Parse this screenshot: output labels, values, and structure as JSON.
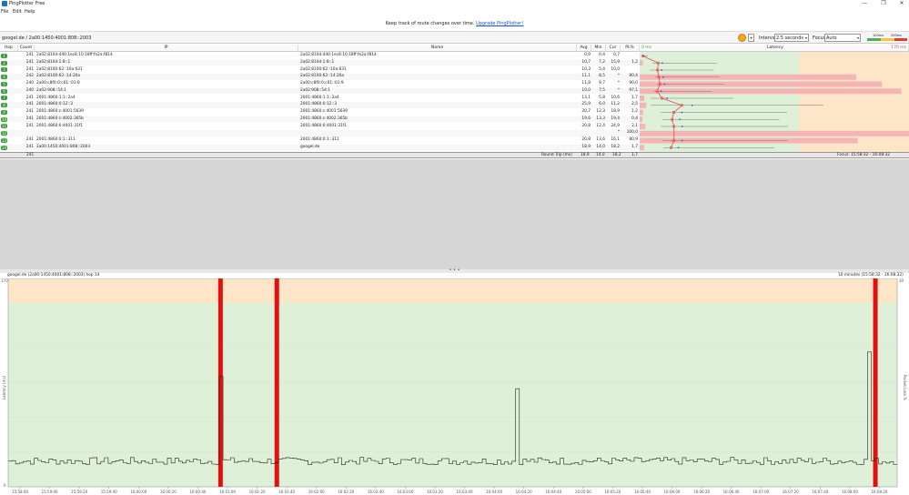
{
  "window": {
    "title": "PingPlotter Free",
    "minimize_glyph": "—",
    "maximize_glyph": "❐",
    "close_glyph": "✕"
  },
  "menu": {
    "items": [
      "File",
      "Edit",
      "Help"
    ]
  },
  "banner": {
    "text": "Keep track of route changes over time.",
    "link": "Upgrade PingPlotter!"
  },
  "toolbar": {
    "target": "googel.de / 2a00:1450:4001:808::2003",
    "interval_label": "Interval",
    "interval_value": "2.5 seconds",
    "focus_label": "Focus",
    "focus_value": "Auto",
    "scale_low": "100ms",
    "scale_high": "200ms",
    "dropdown_glyph": "▾"
  },
  "table": {
    "headers": {
      "hop": "Hop",
      "count": "Count",
      "ip": "IP",
      "name": "Name",
      "avg": "Avg",
      "min": "Min",
      "cur": "Cur",
      "pl": "PL%",
      "latency_min": "0 ms",
      "latency": "Latency",
      "latency_max": "170 ms"
    },
    "rows": [
      {
        "hop": "1",
        "count": "241",
        "ip": "2a02:810d:440:1ec8:10:18ff:fe2a:f814",
        "name": "2a02:810d:440:1ec8:10:18ff:fe2a:f814",
        "avg": "0,9",
        "min": "0,4",
        "cur": "0,7",
        "pl": ""
      },
      {
        "hop": "2",
        "count": "241",
        "ip": "2a02:810d:1:8::1",
        "name": "2a02:810d:1:8::1",
        "avg": "10,7",
        "min": "7,2",
        "cur": "15,9",
        "pl": "1,2"
      },
      {
        "hop": "3",
        "count": "241",
        "ip": "2a02:8100:62::10a:631",
        "name": "2a02:8100:62::10a:631",
        "avg": "10,3",
        "min": "5,4",
        "cur": "10,0",
        "pl": ""
      },
      {
        "hop": "4",
        "count": "242",
        "ip": "2a02:8100:62::14:20a",
        "name": "2a02:8100:62::14:20a",
        "avg": "11,1",
        "min": "8,5",
        "cur": "*",
        "pl": "80,4"
      },
      {
        "hop": "5",
        "count": "240",
        "ip": "2a00:c8f0:0:c01::01:9",
        "name": "2a00:c8f0:0:c01::01:9",
        "avg": "11,8",
        "min": "9,7",
        "cur": "*",
        "pl": "90,0"
      },
      {
        "hop": "6",
        "count": "240",
        "ip": "2a02:908::54:1",
        "name": "2a02:908::54:1",
        "avg": "10,0",
        "min": "7,5",
        "cur": "*",
        "pl": "97,1"
      },
      {
        "hop": "7",
        "count": "241",
        "ip": "2001:4860:1:1::2a4",
        "name": "2001:4860:1:1::2a4",
        "avg": "13,1",
        "min": "5,8",
        "cur": "10,6",
        "pl": "1,7"
      },
      {
        "hop": "8",
        "count": "241",
        "ip": "2001:4860:0:12::3",
        "name": "2001:4860:0:12::3",
        "avg": "25,9",
        "min": "6,0",
        "cur": "11,2",
        "pl": "2,5"
      },
      {
        "hop": "9",
        "count": "241",
        "ip": "2001:4860:c:4001:5639",
        "name": "2001:4860:c:4001:5639",
        "avg": "20,7",
        "min": "12,3",
        "cur": "18,9",
        "pl": "1,2"
      },
      {
        "hop": "10",
        "count": "241",
        "ip": "2001:4860:c:4002:365b",
        "name": "2001:4860:c:4002:365b",
        "avg": "19,6",
        "min": "13,3",
        "cur": "19,4",
        "pl": "0,4"
      },
      {
        "hop": "11",
        "count": "241",
        "ip": "2001:4860:0:4001:31f1",
        "name": "2001:4860:0:4001:31f1",
        "avg": "20,8",
        "min": "12,4",
        "cur": "24,9",
        "pl": "2,1"
      },
      {
        "hop": "12",
        "count": "",
        "ip": "",
        "name": "",
        "avg": "",
        "min": "",
        "cur": "*",
        "pl": "100,0"
      },
      {
        "hop": "13",
        "count": "241",
        "ip": "2001:4860:0:1::311",
        "name": "2001:4860:0:1::311",
        "avg": "20,8",
        "min": "13,6",
        "cur": "16,1",
        "pl": "80,9"
      },
      {
        "hop": "14",
        "count": "241",
        "ip": "2a00:1450:4001:808::2003",
        "name": "googel.de",
        "avg": "18,9",
        "min": "14,0",
        "cur": "18,2",
        "pl": "1,7"
      }
    ],
    "summary": {
      "count": "241",
      "label": "Round Trip (ms)",
      "avg": "18,9",
      "min": "14,0",
      "cur": "18,2",
      "pl": "1,7",
      "focus": "Focus: 15:58:32 - 16:08:32"
    }
  },
  "graph": {
    "title": "googel.de (2a00:1450:4001:808::2003) hop 14",
    "window": "10 minutes (15:58:32 - 16:08:32)",
    "ylabel_left": "Latency (ms)",
    "ylabel_right": "Packet Loss %",
    "y_top_left": "170",
    "y_bottom_left": "0",
    "y_top_right": "30",
    "splitter_glyph": "• • •",
    "time_ticks": [
      "15:58:40",
      "15:59:00",
      "15:59:20",
      "15:59:40",
      "16:00:00",
      "16:00:20",
      "16:00:40",
      "16:01:00",
      "16:01:20",
      "16:01:40",
      "16:02:00",
      "16:02:20",
      "16:02:40",
      "16:03:00",
      "16:03:20",
      "16:03:40",
      "16:04:00",
      "16:04:20",
      "16:04:40",
      "16:05:00",
      "16:05:20",
      "16:05:40",
      "16:06:00",
      "16:06:20",
      "16:06:40",
      "16:07:00",
      "16:07:20",
      "16:07:40",
      "16:08:00",
      "16:08:20"
    ]
  },
  "colors": {
    "zone_good": "#dff0d8",
    "zone_warn": "#fde5c8",
    "zone_bad": "#f5b5b5",
    "loss_bar": "#e31010",
    "latency_line": "#e05050",
    "hop_badge": "#3a9b3a"
  },
  "chart_data": {
    "type": "line",
    "title": "googel.de (2a00:1450:4001:808::2003) hop 14",
    "xlabel": "",
    "ylabel": "Latency (ms)",
    "ylim": [
      0,
      170
    ],
    "x_range": [
      "15:58:32",
      "16:08:32"
    ],
    "baseline_ms": [
      18,
      24
    ],
    "spikes": [
      {
        "time": "16:00:55",
        "value": 90
      },
      {
        "time": "16:04:15",
        "value": 80
      },
      {
        "time": "16:08:12",
        "value": 110
      }
    ],
    "packet_loss_events": [
      "16:00:55",
      "16:01:33",
      "16:08:17"
    ]
  }
}
